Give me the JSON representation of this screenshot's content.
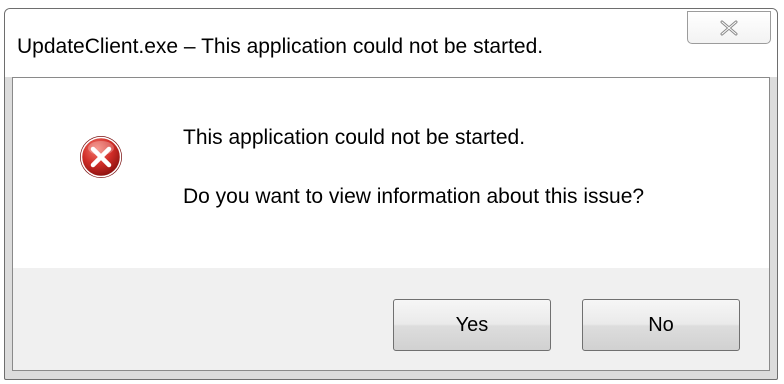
{
  "window": {
    "title": "UpdateClient.exe – This application could not be started.",
    "close_icon": "close-icon"
  },
  "message": {
    "icon": "error-icon",
    "main_text": "This application could not be started.",
    "question_text": "Do you want to view information about this issue?"
  },
  "buttons": {
    "yes_label": "Yes",
    "no_label": "No"
  },
  "colors": {
    "error_red": "#c8282a",
    "window_border": "#6e6e6e",
    "footer_bg": "#f0f0f0"
  }
}
